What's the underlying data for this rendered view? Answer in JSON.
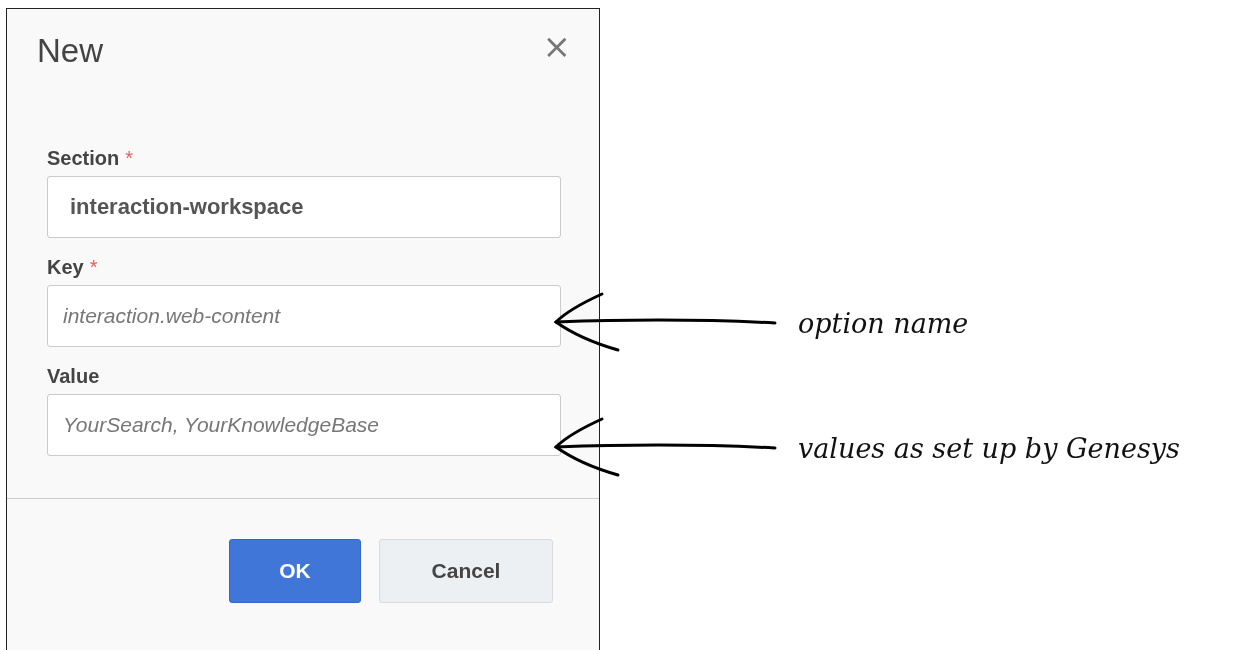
{
  "dialog": {
    "title": "New",
    "close": "×",
    "fields": [
      {
        "label": "Section",
        "required_mark": "*",
        "value": "interaction-workspace"
      },
      {
        "label": "Key",
        "required_mark": "*",
        "placeholder": "interaction.web-content"
      },
      {
        "label": "Value",
        "placeholder": "YourSearch, YourKnowledgeBase"
      }
    ],
    "buttons": [
      {
        "label": "OK",
        "kind": "primary"
      },
      {
        "label": "Cancel",
        "kind": "secondary"
      }
    ]
  },
  "annotations": [
    {
      "text": "option name"
    },
    {
      "text": "values as set up by Genesys"
    }
  ]
}
